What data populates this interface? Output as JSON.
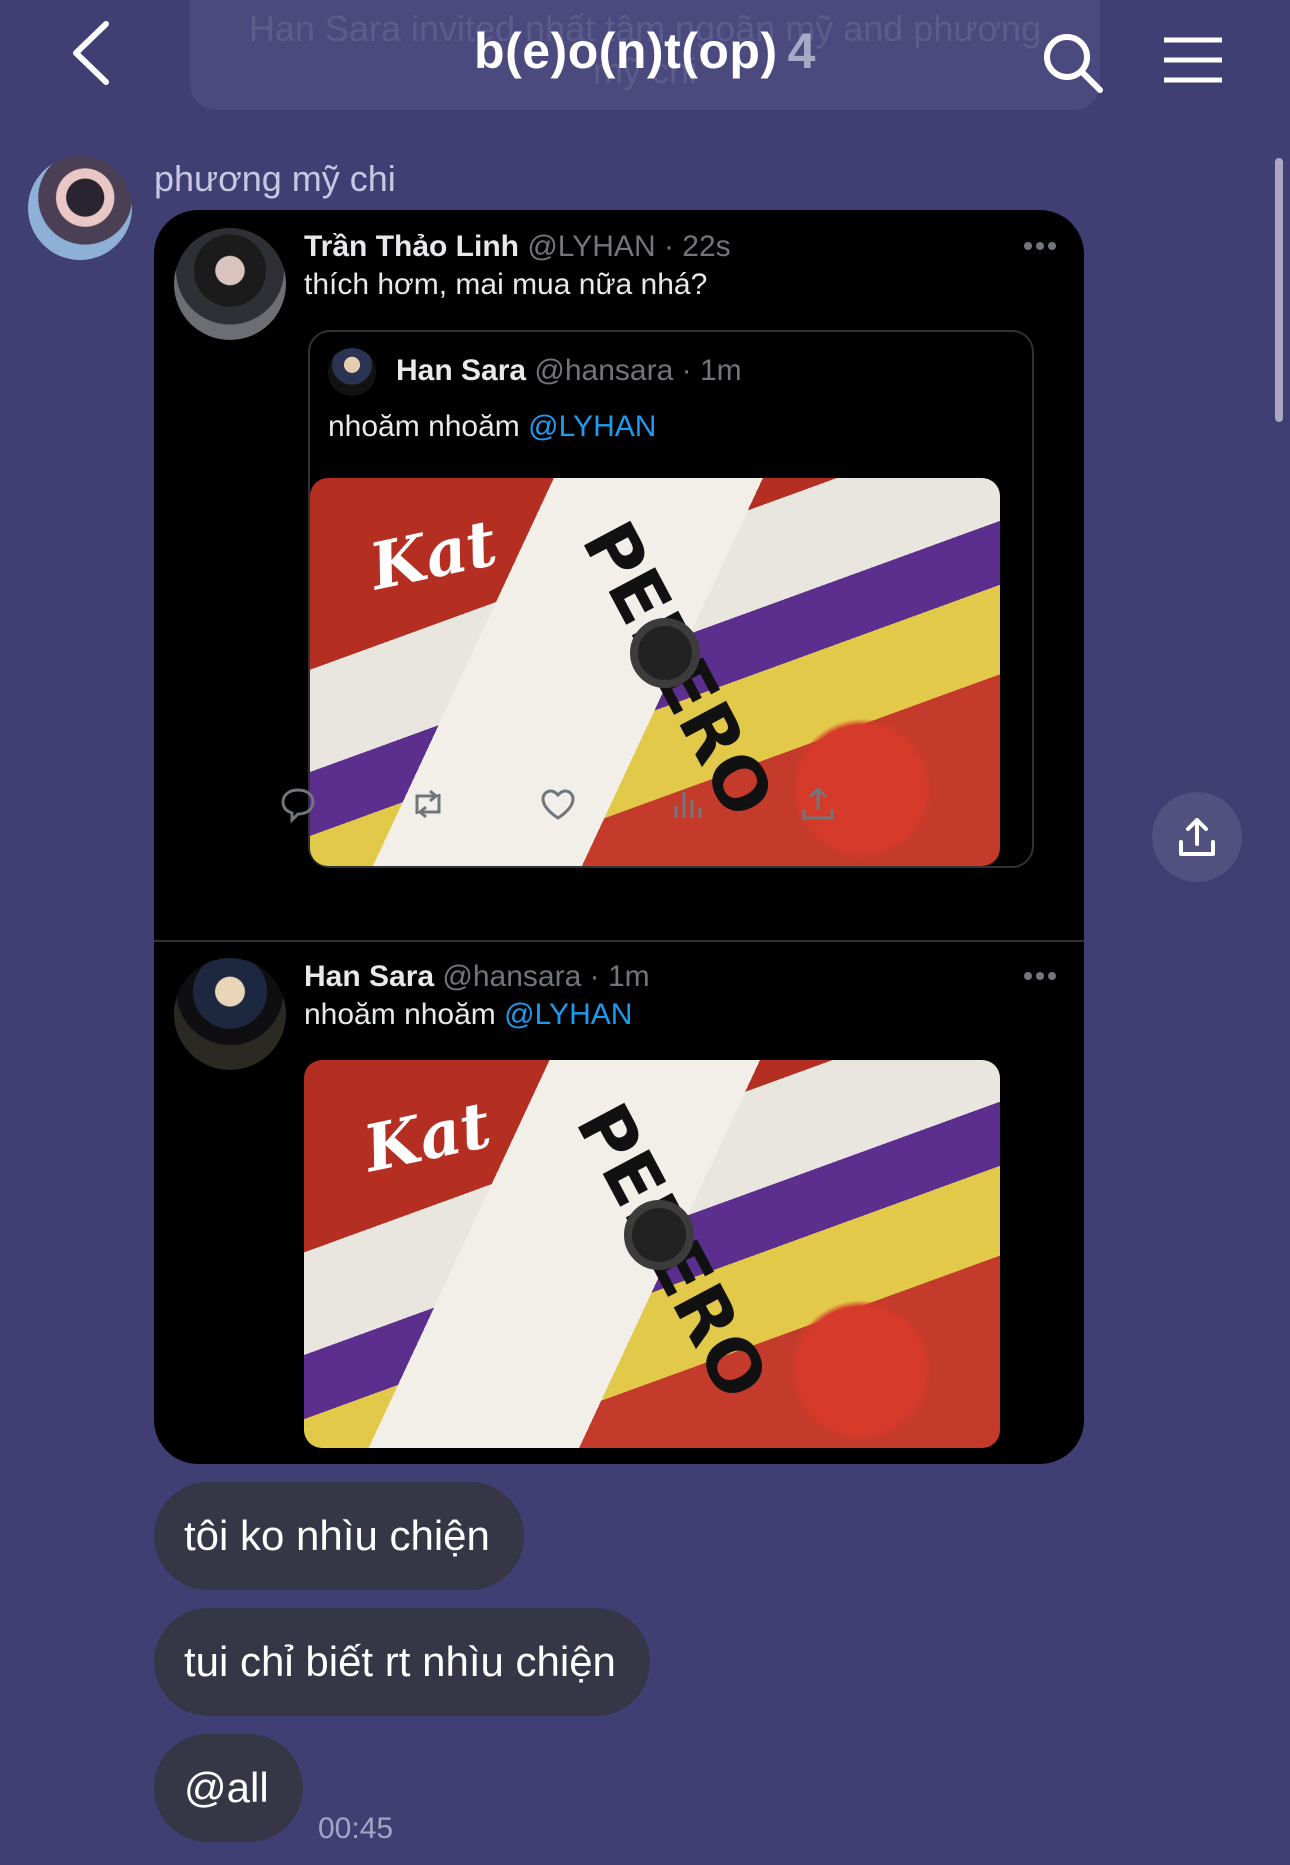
{
  "header": {
    "system_message": "Han Sara invited nhất tâm ngoãn mỹ and phương mỹ chi",
    "title": "b(e)o(n)t(op)",
    "member_count": "4"
  },
  "message": {
    "sender_name": "phương mỹ chi",
    "tweet_screenshot": {
      "tweet1": {
        "name": "Trần Thảo Linh",
        "handle_time": "@LYHAN · 22s",
        "text": "thích hơm, mai mua nữa nhá?"
      },
      "quoted": {
        "name": "Han Sara",
        "handle_time": "@hansara · 1m",
        "text_prefix": "nhoăm nhoăm ",
        "mention": "@LYHAN"
      },
      "photo_labels": {
        "kat": "Kat",
        "pepero": "PEPERO"
      },
      "tweet2": {
        "name": "Han Sara",
        "handle_time": "@hansara · 1m",
        "text_prefix": "nhoăm nhoăm ",
        "mention": "@LYHAN"
      },
      "action_icons": [
        "reply-icon",
        "retweet-icon",
        "like-icon",
        "analytics-icon",
        "share-icon"
      ]
    }
  },
  "bubbles": [
    {
      "text": "tôi ko nhìu chiện"
    },
    {
      "text": "tui chỉ biết rt nhìu chiện"
    },
    {
      "text": "@all"
    }
  ],
  "timestamp": "00:45",
  "colors": {
    "background": "#403f74",
    "bubble": "#363647",
    "mention": "#1d9bf0"
  }
}
